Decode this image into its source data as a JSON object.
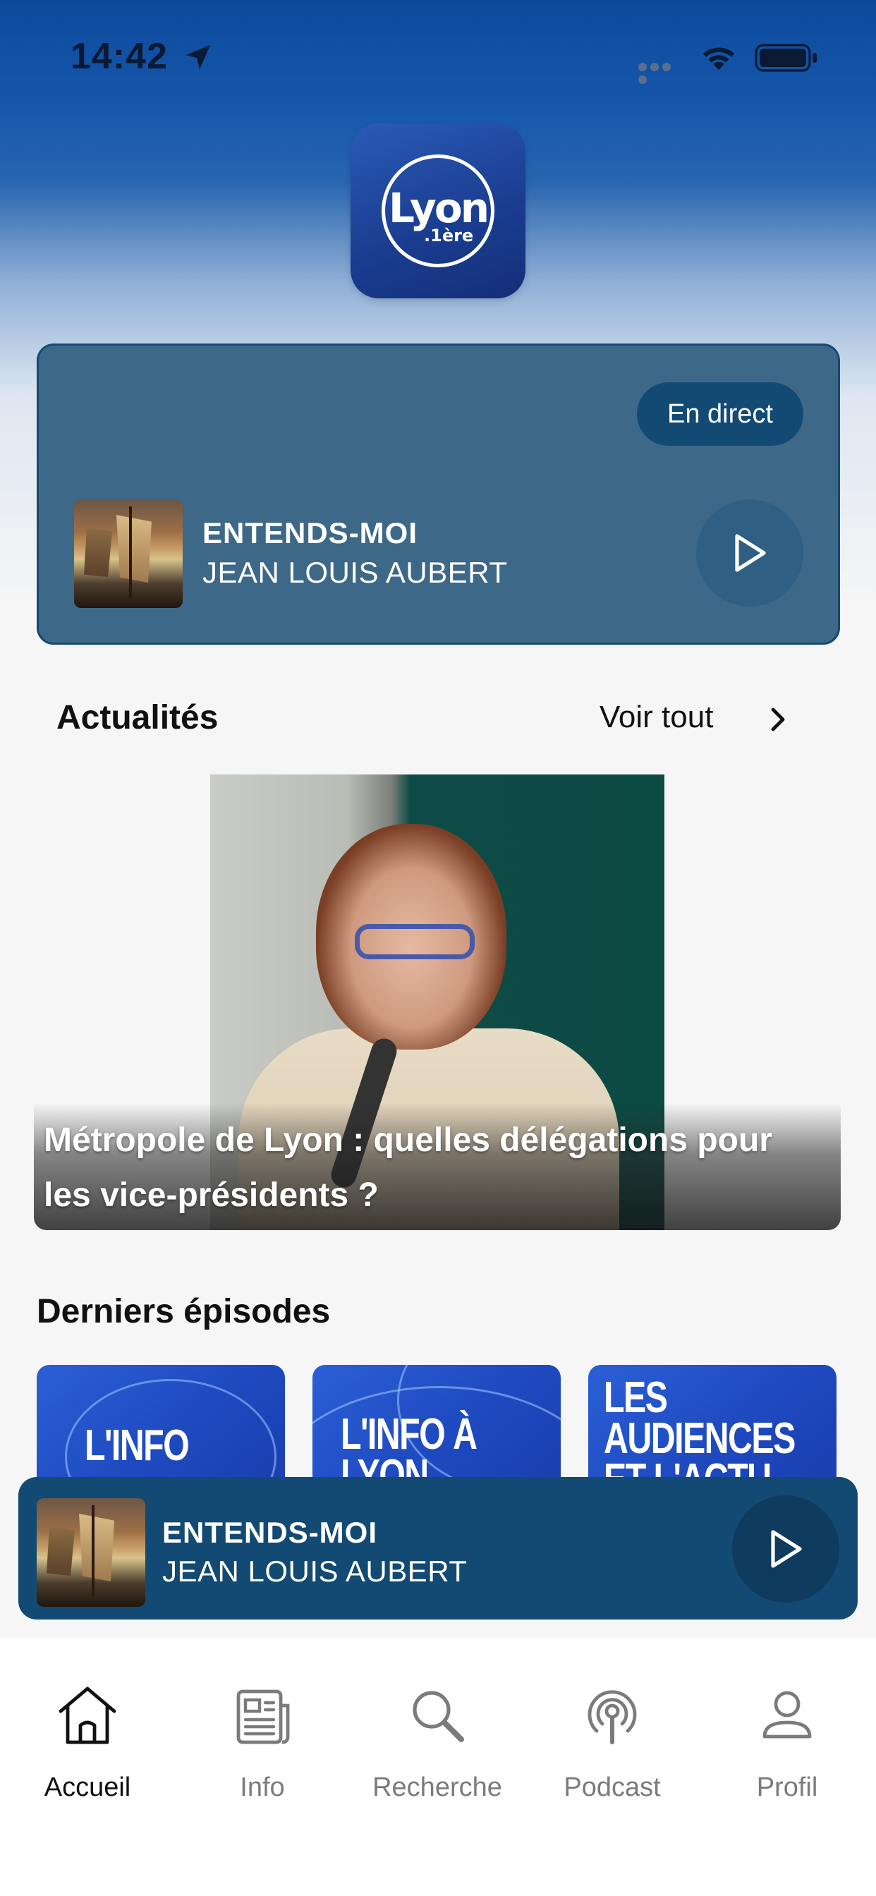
{
  "status_bar": {
    "time": "14:42"
  },
  "logo": {
    "main": "Lyon",
    "sub": ".1ère"
  },
  "live_card": {
    "badge": "En direct",
    "title": "ENTENDS-MOI",
    "artist": "JEAN LOUIS AUBERT"
  },
  "actualites": {
    "title": "Actualités",
    "see_all": "Voir tout",
    "news_title": "Métropole de Lyon : quelles délégations pour les vice-présidents ?"
  },
  "episodes": {
    "title": "Derniers épisodes",
    "items": [
      {
        "label": "L'INFO"
      },
      {
        "label": "L'INFO À LYON"
      },
      {
        "label": "LES AUDIENCES ET L'ACTU TV"
      }
    ]
  },
  "mini_player": {
    "title": "ENTENDS-MOI",
    "artist": "JEAN LOUIS AUBERT"
  },
  "tabs": [
    {
      "label": "Accueil",
      "icon": "home-icon",
      "active": true
    },
    {
      "label": "Info",
      "icon": "newspaper-icon",
      "active": false
    },
    {
      "label": "Recherche",
      "icon": "search-icon",
      "active": false
    },
    {
      "label": "Podcast",
      "icon": "podcast-icon",
      "active": false
    },
    {
      "label": "Profil",
      "icon": "person-icon",
      "active": false
    }
  ],
  "colors": {
    "brand_blue": "#1557ab",
    "live_card": "#3d6888",
    "player": "#124a73",
    "episode_card": "#2155c9"
  }
}
